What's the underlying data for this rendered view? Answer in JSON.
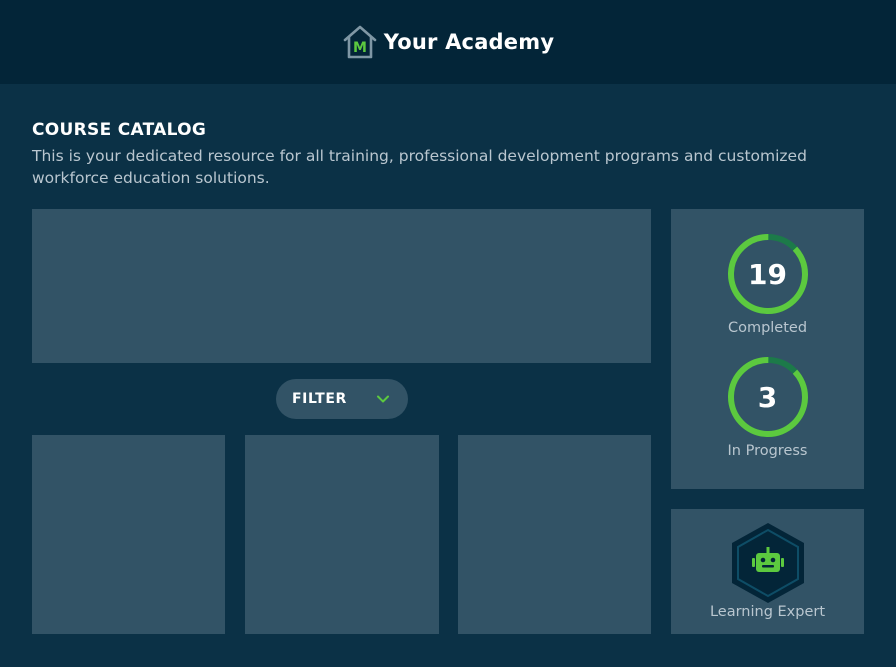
{
  "header": {
    "brand_mark": "M",
    "brand_name": "Your Academy",
    "logo_icon": "house-m-logo-icon"
  },
  "catalog": {
    "title": "COURSE CATALOG",
    "description": "This is your dedicated resource for all training, professional development programs and customized workforce education solutions."
  },
  "filter": {
    "label": "FILTER",
    "icon": "chevron-down-icon"
  },
  "stats": {
    "completed": {
      "value": "19",
      "label": "Completed",
      "progress": 0.87
    },
    "in_progress": {
      "value": "3",
      "label": "In Progress",
      "progress": 0.87
    }
  },
  "badge": {
    "label": "Learning Expert",
    "icon": "robot-icon"
  },
  "colors": {
    "background": "#0b3146",
    "header": "#032538",
    "panel": "#325366",
    "accent_green": "#5cc93f",
    "accent_dark_green": "#1c7a49",
    "muted_text": "#b9c6cf"
  }
}
